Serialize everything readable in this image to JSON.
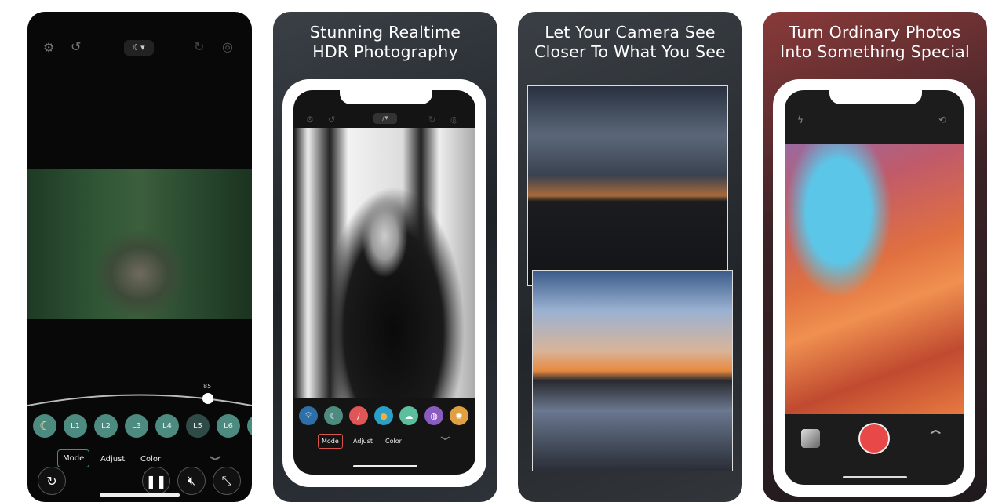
{
  "panel1": {
    "top_icons": [
      "gear-icon",
      "undo-icon",
      "moon-dropdown-icon",
      "redo-icon",
      "settings-dial-icon"
    ],
    "slider": {
      "value": "85",
      "fraction": 0.85
    },
    "modes": [
      {
        "label": "☾",
        "icon": "moon-icon",
        "active": false
      },
      {
        "label": "L1"
      },
      {
        "label": "L2"
      },
      {
        "label": "L3"
      },
      {
        "label": "L4"
      },
      {
        "label": "L5",
        "selected": true
      },
      {
        "label": "L6"
      },
      {
        "label": ""
      }
    ],
    "tabs": [
      "Mode",
      "Adjust",
      "Color"
    ],
    "selected_tab": "Mode",
    "buttons": [
      "reset-icon",
      "pause-icon",
      "mute-icon",
      "expand-icon"
    ],
    "colors": {
      "mode_circle": "#4d8a80",
      "mode_selected": "#2f4b47",
      "tab_border": "#4d8a80"
    }
  },
  "panel2": {
    "title_line1": "Stunning Realtime",
    "title_line2": "HDR Photography",
    "tools": [
      {
        "icon": "lightbulb-icon",
        "color": "#2e6fa7"
      },
      {
        "icon": "moon-icon",
        "color": "#4d8a80"
      },
      {
        "icon": "brush-icon",
        "color": "#e05555"
      },
      {
        "icon": "sun-icon",
        "color": "#2aa0c8"
      },
      {
        "icon": "cloud-icon",
        "color": "#5bbf9e"
      },
      {
        "icon": "planet-icon",
        "color": "#8a5cc0"
      },
      {
        "icon": "aperture-icon",
        "color": "#e0a040"
      }
    ],
    "tabs": [
      "Mode",
      "Adjust",
      "Color"
    ],
    "selected_tab": "Mode",
    "colors": {
      "tab_border": "#d9534f"
    }
  },
  "panel3": {
    "title_line1": "Let Your Camera See",
    "title_line2": "Closer To What You See"
  },
  "panel4": {
    "title_line1": "Turn Ordinary Photos",
    "title_line2": "Into Something Special",
    "colors": {
      "shutter": "#e84848"
    }
  }
}
